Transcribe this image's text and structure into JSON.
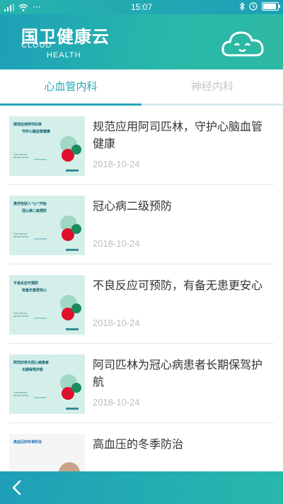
{
  "status_bar": {
    "time": "15:07",
    "left_icons": [
      "signal-icon",
      "wifi-icon",
      "more-icon"
    ],
    "right_icons": [
      "bluetooth-icon",
      "clock-icon",
      "battery-icon"
    ]
  },
  "header": {
    "brand_cn": "国卫健康云",
    "brand_en_1": "CLOUD",
    "brand_en_2": "HEALTH",
    "logo_icon": "cloud-face-icon"
  },
  "tabs": [
    {
      "label": "心血管内科",
      "active": true
    },
    {
      "label": "神经内科",
      "active": false
    }
  ],
  "articles": [
    {
      "title": "规范应用阿司匹林，守护心脑血管健康",
      "date": "2018-10-24",
      "thumb_line1": "规范应用阿司匹林",
      "thumb_line2": "守护心脑血管健康"
    },
    {
      "title": "冠心病二级预防",
      "date": "2018-10-24",
      "thumb_line1": "勇抒告别人“心”开始",
      "thumb_line2": "冠心病二级预防"
    },
    {
      "title": "不良反应可预防，有备无患更安心",
      "date": "2018-10-24",
      "thumb_line1": "不良反应可预防",
      "thumb_line2": "有备无患更安心"
    },
    {
      "title": "阿司匹林为冠心病患者长期保驾护航",
      "date": "2018-10-24",
      "thumb_line1": "阿司匹林为冠心病患者",
      "thumb_line2": "长期保驾护航"
    },
    {
      "title": "高血压的冬季防治",
      "date": "",
      "thumb_line1": "高血压的冬季防治",
      "thumb_line2": ""
    }
  ],
  "thumb_brand": "THE MIRROR BRAND BAYER",
  "bottom_bar": {
    "back_icon": "chevron-left-icon"
  },
  "colors": {
    "accent": "#27a6b7",
    "header_start": "#1e9fb8",
    "header_end": "#2fb9a4",
    "text": "#333333",
    "muted": "#bdbdbd"
  }
}
